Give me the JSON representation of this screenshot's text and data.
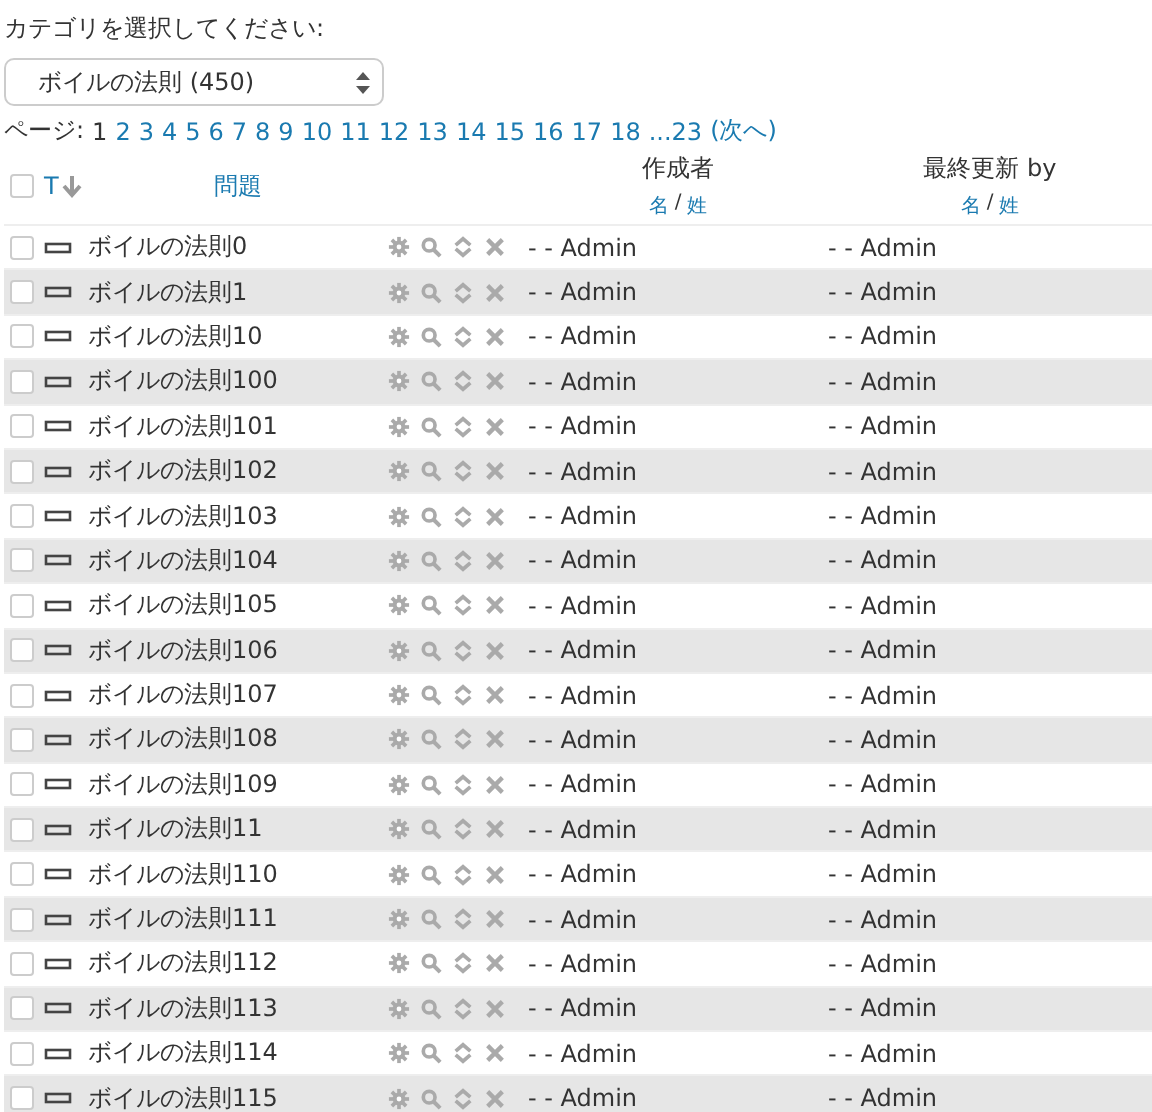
{
  "category_label": "カテゴリを選択してください:",
  "category_select": {
    "value": "ボイルの法則 (450)"
  },
  "pagination": {
    "label": "ページ:",
    "pages": [
      {
        "label": "1",
        "selected": true
      },
      {
        "label": "2",
        "selected": false
      },
      {
        "label": "3",
        "selected": false
      },
      {
        "label": "4",
        "selected": false
      },
      {
        "label": "5",
        "selected": false
      },
      {
        "label": "6",
        "selected": false
      },
      {
        "label": "7",
        "selected": false
      },
      {
        "label": "8",
        "selected": false
      },
      {
        "label": "9",
        "selected": false
      },
      {
        "label": "10",
        "selected": false
      },
      {
        "label": "11",
        "selected": false
      },
      {
        "label": "12",
        "selected": false
      },
      {
        "label": "13",
        "selected": false
      },
      {
        "label": "14",
        "selected": false
      },
      {
        "label": "15",
        "selected": false
      },
      {
        "label": "16",
        "selected": false
      },
      {
        "label": "17",
        "selected": false
      },
      {
        "label": "18",
        "selected": false
      },
      {
        "label": "...23",
        "selected": false
      }
    ],
    "next": "(次へ)"
  },
  "table": {
    "select_all": {
      "checked": false
    },
    "columns": {
      "type": "T",
      "question": "問題",
      "author": {
        "title": "作成者",
        "first": "名",
        "separator": "/",
        "last": "姓"
      },
      "modified": {
        "title": "最終更新 by",
        "first": "名",
        "separator": "/",
        "last": "姓"
      }
    },
    "rows": [
      {
        "checked": false,
        "name": "ボイルの法則0",
        "author": "- - Admin",
        "modified": "- - Admin"
      },
      {
        "checked": false,
        "name": "ボイルの法則1",
        "author": "- - Admin",
        "modified": "- - Admin"
      },
      {
        "checked": false,
        "name": "ボイルの法則10",
        "author": "- - Admin",
        "modified": "- - Admin"
      },
      {
        "checked": false,
        "name": "ボイルの法則100",
        "author": "- - Admin",
        "modified": "- - Admin"
      },
      {
        "checked": false,
        "name": "ボイルの法則101",
        "author": "- - Admin",
        "modified": "- - Admin"
      },
      {
        "checked": false,
        "name": "ボイルの法則102",
        "author": "- - Admin",
        "modified": "- - Admin"
      },
      {
        "checked": false,
        "name": "ボイルの法則103",
        "author": "- - Admin",
        "modified": "- - Admin"
      },
      {
        "checked": false,
        "name": "ボイルの法則104",
        "author": "- - Admin",
        "modified": "- - Admin"
      },
      {
        "checked": false,
        "name": "ボイルの法則105",
        "author": "- - Admin",
        "modified": "- - Admin"
      },
      {
        "checked": false,
        "name": "ボイルの法則106",
        "author": "- - Admin",
        "modified": "- - Admin"
      },
      {
        "checked": false,
        "name": "ボイルの法則107",
        "author": "- - Admin",
        "modified": "- - Admin"
      },
      {
        "checked": false,
        "name": "ボイルの法則108",
        "author": "- - Admin",
        "modified": "- - Admin"
      },
      {
        "checked": false,
        "name": "ボイルの法則109",
        "author": "- - Admin",
        "modified": "- - Admin"
      },
      {
        "checked": false,
        "name": "ボイルの法則11",
        "author": "- - Admin",
        "modified": "- - Admin"
      },
      {
        "checked": false,
        "name": "ボイルの法則110",
        "author": "- - Admin",
        "modified": "- - Admin"
      },
      {
        "checked": false,
        "name": "ボイルの法則111",
        "author": "- - Admin",
        "modified": "- - Admin"
      },
      {
        "checked": false,
        "name": "ボイルの法則112",
        "author": "- - Admin",
        "modified": "- - Admin"
      },
      {
        "checked": false,
        "name": "ボイルの法則113",
        "author": "- - Admin",
        "modified": "- - Admin"
      },
      {
        "checked": false,
        "name": "ボイルの法則114",
        "author": "- - Admin",
        "modified": "- - Admin"
      },
      {
        "checked": false,
        "name": "ボイルの法則115",
        "author": "- - Admin",
        "modified": "- - Admin"
      }
    ]
  }
}
